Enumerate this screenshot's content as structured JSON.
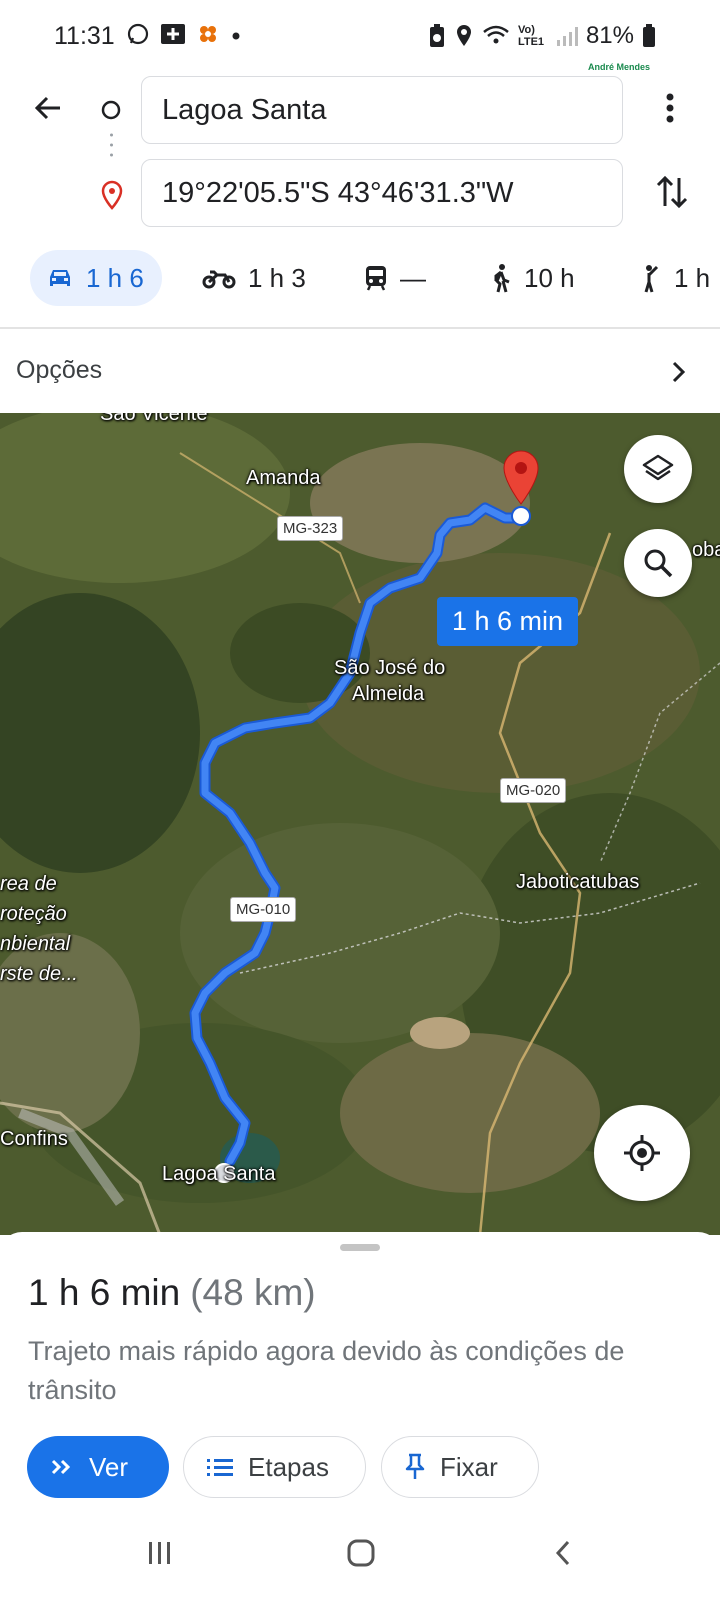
{
  "status_bar": {
    "time": "11:31",
    "network": "Vo) LTE1",
    "battery": "81%",
    "watermark": "André Mendes"
  },
  "directions": {
    "origin": "Lagoa Santa",
    "destination": "19°22'05.5\"S 43°46'31.3\"W"
  },
  "travel_modes": [
    {
      "name": "car",
      "label": "1 h 6",
      "selected": true
    },
    {
      "name": "motorcycle",
      "label": "1 h 3"
    },
    {
      "name": "transit",
      "label": "—"
    },
    {
      "name": "walk",
      "label": "10 h"
    },
    {
      "name": "ride",
      "label": "1 h"
    }
  ],
  "options": {
    "label": "Opções"
  },
  "map": {
    "eta_badge": "1 h 6 min",
    "places": [
      "São Vicente",
      "Amanda",
      "São José do",
      "Almeida",
      "Jaboticatubas",
      "rea de",
      "roteção",
      "nbiental",
      "rste de...",
      "Confins",
      "Lagoa Santa",
      "oba"
    ],
    "roads": [
      "MG-323",
      "MG-020",
      "MG-010"
    ],
    "route_color": "#4285f4",
    "pin_color": "#ea4335"
  },
  "summary": {
    "duration": "1 h 6 min",
    "distance": "(48 km)",
    "description": "Trajeto mais rápido agora devido às condições de trânsito"
  },
  "actions": {
    "view": "Ver",
    "steps": "Etapas",
    "pin": "Fixar"
  },
  "accent": "#1a73e8"
}
